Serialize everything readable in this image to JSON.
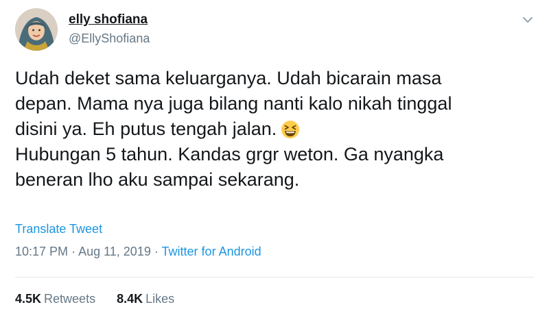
{
  "user": {
    "display_name": "elly shofiana",
    "handle": "@EllyShofiana",
    "avatar_icon": "profile-photo"
  },
  "tweet": {
    "lines": [
      "Udah deket sama keluarganya. Udah bicarain masa",
      "depan. Mama nya juga bilang nanti kalo nikah tinggal",
      "disini ya. Eh putus tengah jalan.",
      "Hubungan 5 tahun. Kandas grgr weton. Ga nyangka",
      "beneran lho aku sampai sekarang."
    ],
    "emoji": "grinning-squinting-face-emoji",
    "translate_label": "Translate Tweet"
  },
  "meta": {
    "time": "10:17 PM",
    "separator": "·",
    "date": "Aug 11, 2019",
    "source": "Twitter for Android"
  },
  "stats": {
    "retweets_count": "4.5K",
    "retweets_label": "Retweets",
    "likes_count": "8.4K",
    "likes_label": "Likes"
  },
  "colors": {
    "link": "#1b95e0",
    "secondary_text": "#657786",
    "primary_text": "#14171a",
    "divider": "#e1e8ed"
  }
}
